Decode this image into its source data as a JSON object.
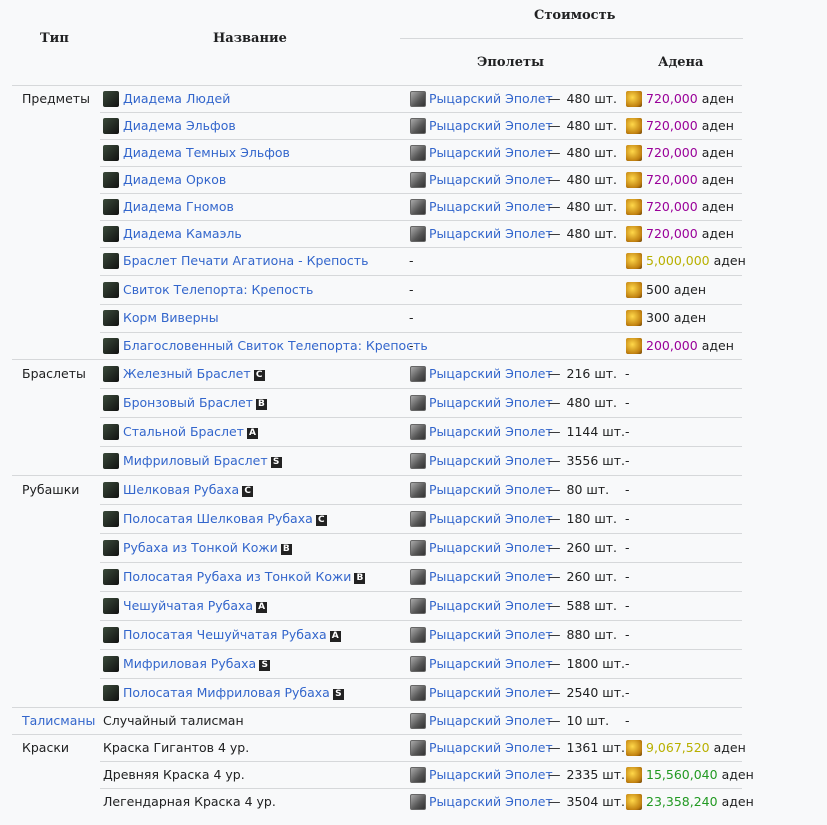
{
  "header": {
    "col_type": "Тип",
    "col_name": "Название",
    "col_cost": "Стоимость",
    "col_epaulets": "Эполеты",
    "col_adena": "Адена"
  },
  "colors": {
    "link": "#3366cc",
    "adena_purple": "#990099",
    "adena_yellow": "#b8b000",
    "adena_green": "#229922"
  },
  "icons": {
    "item": "item-icon",
    "epaulet": "epaulet-icon",
    "adena": "adena-icon"
  },
  "rows": [
    {
      "type": "Предметы",
      "name": "Диадема Людей",
      "link": true,
      "grade": "",
      "icon": true,
      "ep": "Рыцарский Эполет",
      "ep_sep": "—",
      "ep_qty": "480 шт.",
      "ad_val": "720,000",
      "ad_unit": "аден",
      "ad_color": "#990099"
    },
    {
      "type": "",
      "name": "Диадема Эльфов",
      "link": true,
      "grade": "",
      "icon": true,
      "ep": "Рыцарский Эполет",
      "ep_sep": "—",
      "ep_qty": "480 шт.",
      "ad_val": "720,000",
      "ad_unit": "аден",
      "ad_color": "#990099"
    },
    {
      "type": "",
      "name": "Диадема Темных Эльфов",
      "link": true,
      "grade": "",
      "icon": true,
      "ep": "Рыцарский Эполет",
      "ep_sep": "—",
      "ep_qty": "480 шт.",
      "ad_val": "720,000",
      "ad_unit": "аден",
      "ad_color": "#990099"
    },
    {
      "type": "",
      "name": "Диадема Орков",
      "link": true,
      "grade": "",
      "icon": true,
      "ep": "Рыцарский Эполет",
      "ep_sep": "—",
      "ep_qty": "480 шт.",
      "ad_val": "720,000",
      "ad_unit": "аден",
      "ad_color": "#990099"
    },
    {
      "type": "",
      "name": "Диадема Гномов",
      "link": true,
      "grade": "",
      "icon": true,
      "ep": "Рыцарский Эполет",
      "ep_sep": "—",
      "ep_qty": "480 шт.",
      "ad_val": "720,000",
      "ad_unit": "аден",
      "ad_color": "#990099"
    },
    {
      "type": "",
      "name": "Диадема Камаэль",
      "link": true,
      "grade": "",
      "icon": true,
      "ep": "Рыцарский Эполет",
      "ep_sep": "—",
      "ep_qty": "480 шт.",
      "ad_val": "720,000",
      "ad_unit": "аден",
      "ad_color": "#990099"
    },
    {
      "type": "",
      "name": "Браслет Печати Агатиона - Крепость",
      "link": true,
      "grade": "",
      "icon": true,
      "ep": "",
      "ep_sep": "",
      "ep_qty": "",
      "ep_dash": "-",
      "ad_val": "5,000,000",
      "ad_unit": "аден",
      "ad_color": "#b8b000"
    },
    {
      "type": "",
      "name": "Свиток Телепорта: Крепость",
      "link": true,
      "grade": "",
      "icon": true,
      "ep": "",
      "ep_sep": "",
      "ep_qty": "",
      "ep_dash": "-",
      "ad_val": "",
      "ad_unit": "500 аден",
      "ad_color": "#202122"
    },
    {
      "type": "",
      "name": "Корм Виверны",
      "link": true,
      "grade": "",
      "icon": true,
      "ep": "",
      "ep_sep": "",
      "ep_qty": "",
      "ep_dash": "-",
      "ad_val": "",
      "ad_unit": "300 аден",
      "ad_color": "#202122"
    },
    {
      "type": "",
      "name": "Благословенный Свиток Телепорта: Крепость",
      "link": true,
      "grade": "",
      "icon": true,
      "ep": "",
      "ep_sep": "",
      "ep_qty": "",
      "ep_dash": "-",
      "ad_val": "200,000",
      "ad_unit": "аден",
      "ad_color": "#990099"
    },
    {
      "type": "Браслеты",
      "name": "Железный Браслет",
      "link": true,
      "grade": "C",
      "icon": true,
      "ep": "Рыцарский Эполет",
      "ep_sep": "—",
      "ep_qty": "216 шт.",
      "ad_dash": "-"
    },
    {
      "type": "",
      "name": "Бронзовый Браслет",
      "link": true,
      "grade": "B",
      "icon": true,
      "ep": "Рыцарский Эполет",
      "ep_sep": "—",
      "ep_qty": "480 шт.",
      "ad_dash": "-"
    },
    {
      "type": "",
      "name": "Стальной Браслет",
      "link": true,
      "grade": "A",
      "icon": true,
      "ep": "Рыцарский Эполет",
      "ep_sep": "—",
      "ep_qty": "1144 шт.",
      "ad_dash": "-"
    },
    {
      "type": "",
      "name": "Мифриловый Браслет",
      "link": true,
      "grade": "S",
      "icon": true,
      "ep": "Рыцарский Эполет",
      "ep_sep": "—",
      "ep_qty": "3556 шт.",
      "ad_dash": "-"
    },
    {
      "type": "Рубашки",
      "name": "Шелковая Рубаха",
      "link": true,
      "grade": "C",
      "icon": true,
      "ep": "Рыцарский Эполет",
      "ep_sep": "—",
      "ep_qty": "80 шт.",
      "ad_dash": "-"
    },
    {
      "type": "",
      "name": "Полосатая Шелковая Рубаха",
      "link": true,
      "grade": "C",
      "icon": true,
      "ep": "Рыцарский Эполет",
      "ep_sep": "—",
      "ep_qty": "180 шт.",
      "ad_dash": "-"
    },
    {
      "type": "",
      "name": "Рубаха из Тонкой Кожи",
      "link": true,
      "grade": "B",
      "icon": true,
      "ep": "Рыцарский Эполет",
      "ep_sep": "—",
      "ep_qty": "260 шт.",
      "ad_dash": "-"
    },
    {
      "type": "",
      "name": "Полосатая Рубаха из Тонкой Кожи",
      "link": true,
      "grade": "B",
      "icon": true,
      "ep": "Рыцарский Эполет",
      "ep_sep": "—",
      "ep_qty": "260 шт.",
      "ad_dash": "-"
    },
    {
      "type": "",
      "name": "Чешуйчатая Рубаха",
      "link": true,
      "grade": "A",
      "icon": true,
      "ep": "Рыцарский Эполет",
      "ep_sep": "—",
      "ep_qty": "588 шт.",
      "ad_dash": "-"
    },
    {
      "type": "",
      "name": "Полосатая Чешуйчатая Рубаха",
      "link": true,
      "grade": "A",
      "icon": true,
      "ep": "Рыцарский Эполет",
      "ep_sep": "—",
      "ep_qty": "880 шт.",
      "ad_dash": "-"
    },
    {
      "type": "",
      "name": "Мифриловая Рубаха",
      "link": true,
      "grade": "S",
      "icon": true,
      "ep": "Рыцарский Эполет",
      "ep_sep": "—",
      "ep_qty": "1800 шт.",
      "ad_dash": "-"
    },
    {
      "type": "",
      "name": "Полосатая Мифриловая Рубаха",
      "link": true,
      "grade": "S",
      "icon": true,
      "ep": "Рыцарский Эполет",
      "ep_sep": "—",
      "ep_qty": "2540 шт.",
      "ad_dash": "-"
    },
    {
      "type": "Талисманы",
      "type_link": true,
      "name": "Случайный талисман",
      "link": false,
      "grade": "",
      "icon": false,
      "ep": "Рыцарский Эполет",
      "ep_sep": "—",
      "ep_qty": "10 шт.",
      "ad_dash": "-"
    },
    {
      "type": "Краски",
      "name": "Краска Гигантов 4 ур.",
      "link": false,
      "grade": "",
      "icon": false,
      "ep": "Рыцарский Эполет",
      "ep_sep": "—",
      "ep_qty": "1361 шт.",
      "ad_val": "9,067,520",
      "ad_unit": "аден",
      "ad_color": "#b8b000"
    },
    {
      "type": "",
      "name": "Древняя Краска 4 ур.",
      "link": false,
      "grade": "",
      "icon": false,
      "ep": "Рыцарский Эполет",
      "ep_sep": "—",
      "ep_qty": "2335 шт.",
      "ad_val": "15,560,040",
      "ad_unit": "аден",
      "ad_color": "#229922"
    },
    {
      "type": "",
      "name": "Легендарная Краска 4 ур.",
      "link": false,
      "grade": "",
      "icon": false,
      "ep": "Рыцарский Эполет",
      "ep_sep": "—",
      "ep_qty": "3504 шт.",
      "ad_val": "23,358,240",
      "ad_unit": "аден",
      "ad_color": "#229922"
    }
  ]
}
